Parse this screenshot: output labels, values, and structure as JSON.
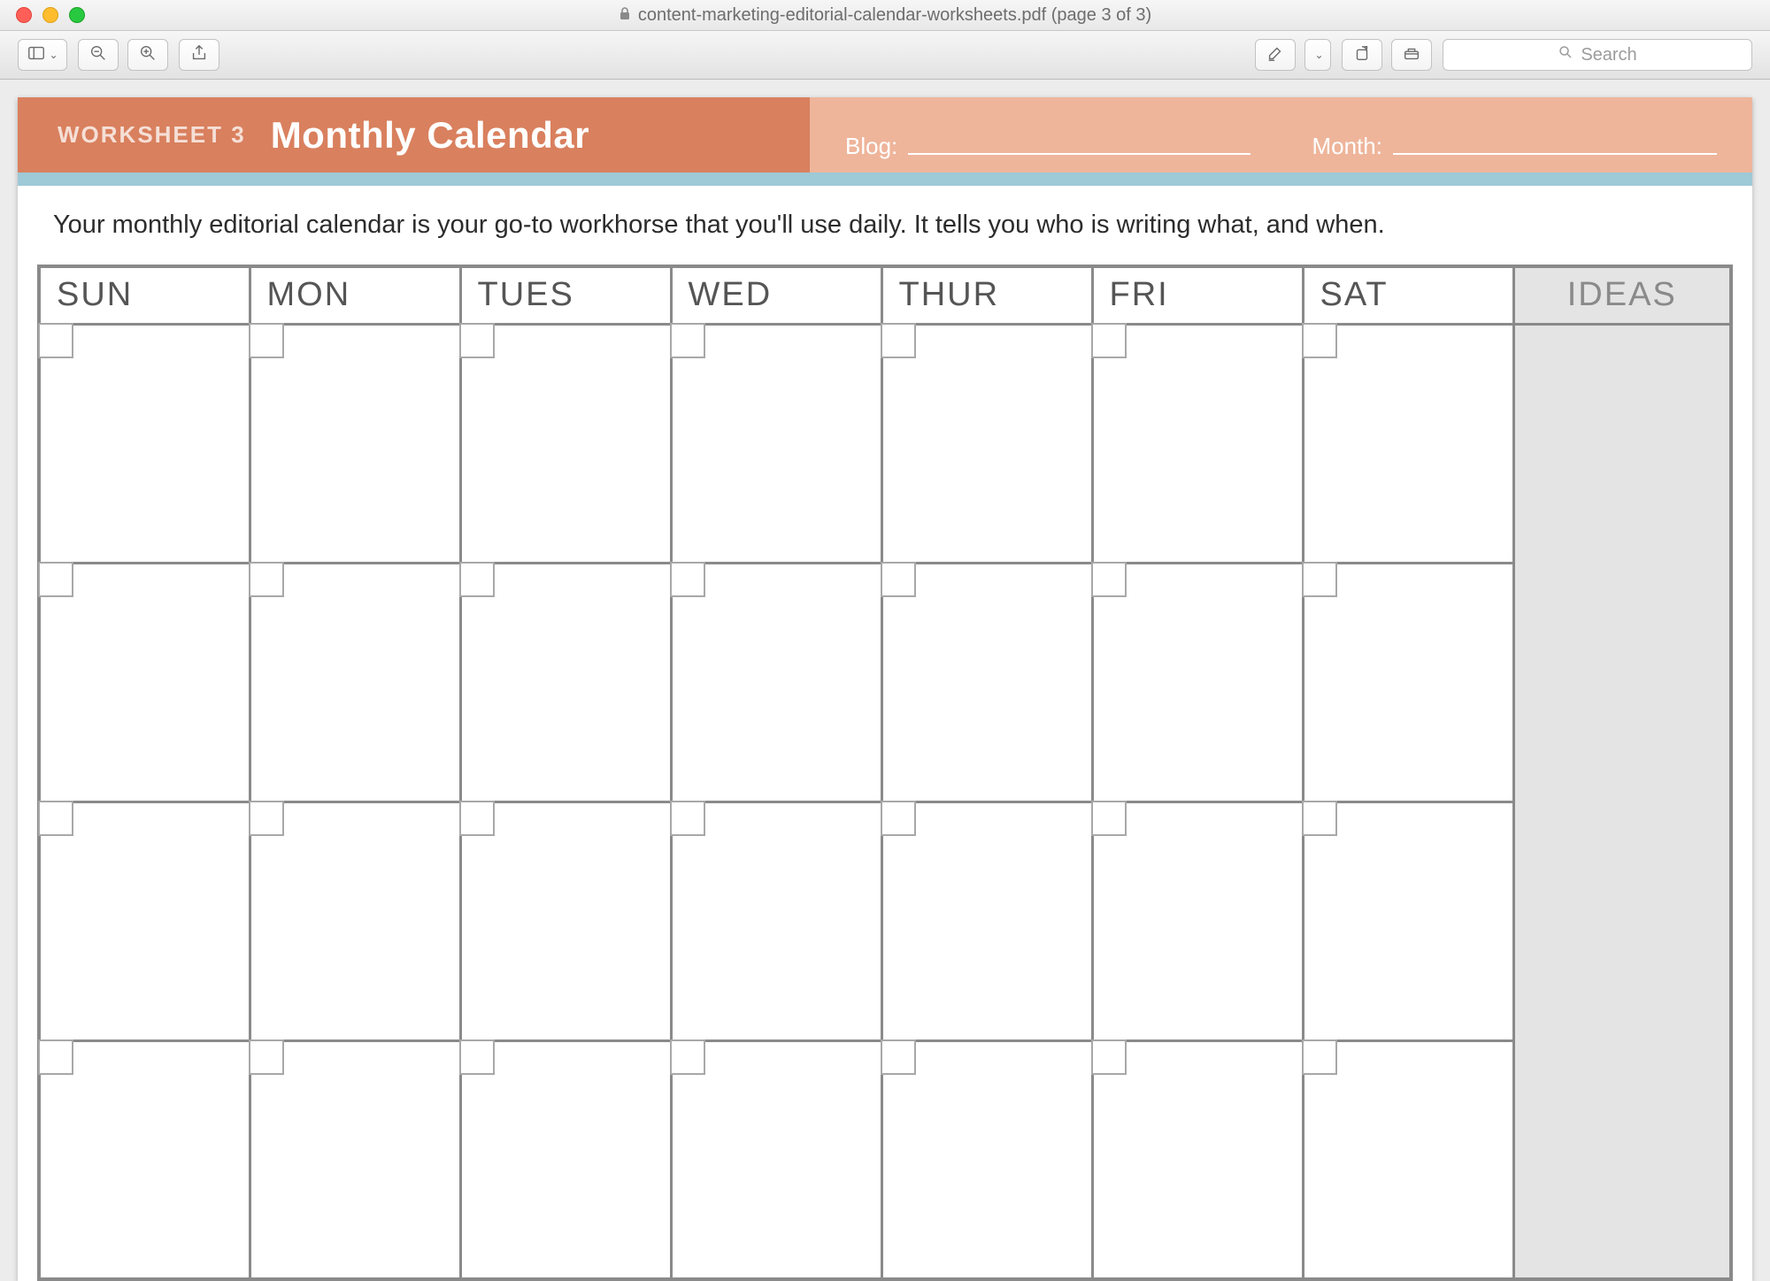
{
  "window": {
    "title": "content-marketing-editorial-calendar-worksheets.pdf (page 3 of 3)"
  },
  "toolbar": {
    "search_placeholder": "Search"
  },
  "document": {
    "worksheet_label": "WORKSHEET 3",
    "title": "Monthly Calendar",
    "blog_label": "Blog:",
    "month_label": "Month:",
    "description": "Your monthly editorial calendar is your go-to workhorse that you'll use daily. It tells you who is writing what, and when.",
    "days": [
      "SUN",
      "MON",
      "TUES",
      "WED",
      "THUR",
      "FRI",
      "SAT"
    ],
    "ideas_label": "IDEAS",
    "visible_rows": 4
  },
  "colors": {
    "banner_primary": "#d9805e",
    "banner_secondary": "#eeb59b",
    "accent": "#9ec9d7",
    "grid_border": "#8a8a8a",
    "ideas_bg": "#e4e4e4"
  }
}
